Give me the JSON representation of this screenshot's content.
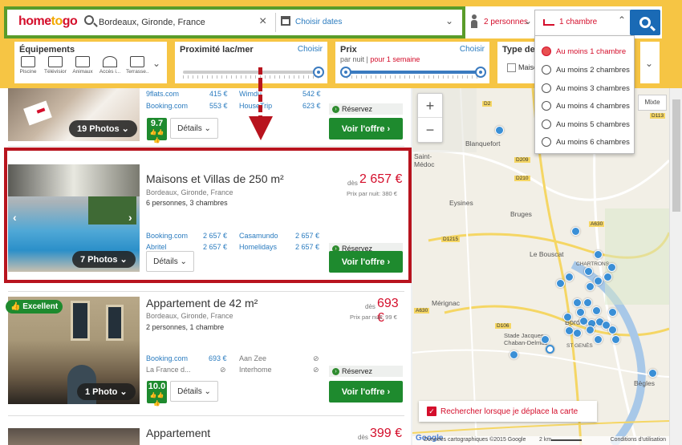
{
  "header": {
    "logo_a": "home",
    "logo_b": "to",
    "logo_c": "go",
    "destination": "Bordeaux, Gironde, France",
    "dates_placeholder": "Choisir dates",
    "persons": "2 personnes",
    "rooms": "1 chambre",
    "clear_icon": "×",
    "chevron": "⌄"
  },
  "filters": {
    "equipements": {
      "title": "Équipements",
      "items": [
        "Piscine",
        "Télévision",
        "Animaux",
        "Accès i...",
        "Terrasse..."
      ]
    },
    "proximite": {
      "title": "Proximité lac/mer",
      "link": "Choisir"
    },
    "prix": {
      "title": "Prix",
      "link": "Choisir",
      "sub_a": "par nuit",
      "sub_sep": " | ",
      "sub_b": "pour 1 semaine"
    },
    "type": {
      "title": "Type de",
      "option": "Maiso"
    }
  },
  "rooms_dropdown": {
    "options": [
      "Au moins 1 chambre",
      "Au moins 2 chambres",
      "Au moins 3 chambres",
      "Au moins 4 chambres",
      "Au moins 5 chambres",
      "Au moins 6 chambres"
    ],
    "selected": 0
  },
  "listings": [
    {
      "photos": "19 Photos",
      "providers": [
        {
          "name": "9flats.com",
          "price": "415 €"
        },
        {
          "name": "Wimdu",
          "price": "542 €"
        },
        {
          "name": "Booking.com",
          "price": "553 €"
        },
        {
          "name": "HouseTrip",
          "price": "623 €"
        }
      ],
      "score": "9.7",
      "details": "Détails",
      "reserve": "Réservez",
      "offer": "Voir l'offre"
    },
    {
      "title": "Maisons et Villas de 250 m²",
      "address": "Bordeaux, Gironde, France",
      "info_a": "6",
      "info_b": " personnes, ",
      "info_c": "3",
      "info_d": " chambres",
      "price_prefix": "dès",
      "price": "2 657 €",
      "per_night": "Prix par nuit: 380 €",
      "photos": "7 Photos",
      "providers": [
        {
          "name": "Booking.com",
          "price": "2 657 €"
        },
        {
          "name": "Casamundo",
          "price": "2 657 €"
        },
        {
          "name": "Abritel",
          "price": "2 657 €"
        },
        {
          "name": "Homelidays",
          "price": "2 657 €"
        }
      ],
      "details": "Détails",
      "reserve": "Réservez",
      "offer": "Voir l'offre"
    },
    {
      "badge": "Excellent",
      "title": "Appartement de 42 m²",
      "address": "Bordeaux, Gironde, France",
      "info_a": "2",
      "info_b": " personnes, ",
      "info_c": "1",
      "info_d": " chambre",
      "price_prefix": "dès",
      "price": "693 €",
      "per_night": "Prix par nuit: 99 €",
      "photos": "1 Photo",
      "providers": [
        {
          "name": "Booking.com",
          "price": "693 €"
        },
        {
          "name": "Aan Zee",
          "price": "⊘"
        },
        {
          "name": "La France d...",
          "price": "⊘"
        },
        {
          "name": "Interhome",
          "price": "⊘"
        }
      ],
      "score": "10.0",
      "details": "Détails",
      "reserve": "Réservez",
      "offer": "Voir l'offre"
    },
    {
      "title": "Appartement",
      "price_prefix": "dès",
      "price": "399 €"
    }
  ],
  "map": {
    "zoom_in": "+",
    "zoom_out": "−",
    "mixte": "Mixte",
    "labels": [
      "Blanquefort",
      "Eysines",
      "Bruges",
      "Le Bouscat",
      "Mérignac",
      "Stade Jacques Chaban-Delmas",
      "Bègles",
      "Saint-Médoc",
      "CHARTRONS",
      "ST GENÈS",
      "Bord"
    ],
    "roads": [
      "D2",
      "D209",
      "D210",
      "A630",
      "D1215",
      "A630",
      "D106",
      "D113"
    ],
    "recherche": "Rechercher lorsque je déplace la carte",
    "footer_google": "Google",
    "footer": "Données cartographiques ©2015 Google",
    "footer_scale": "2 km",
    "footer_cgu": "Conditions d'utilisation"
  },
  "colors": {
    "brand_red": "#d40e2b",
    "header_yellow": "#f6c544",
    "green": "#1e8a2e",
    "link_blue": "#2a7bbf",
    "annotation_red": "#b8141e",
    "annotation_green": "#5a9c2a"
  }
}
